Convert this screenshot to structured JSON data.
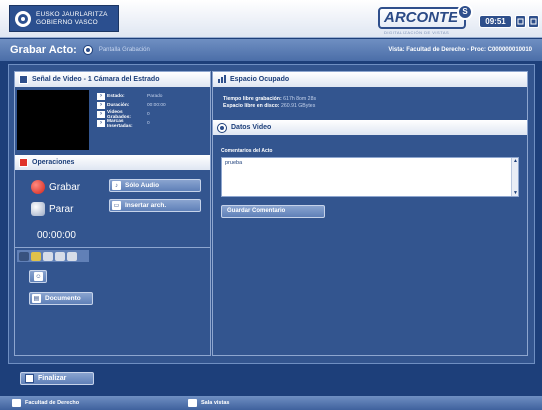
{
  "header": {
    "logo_line1": "EUSKO JAURLARITZA",
    "logo_line2": "GOBIERNO VASCO",
    "brand": "ARCONTE",
    "brand_badge": "S",
    "brand_sub": "DIGITALIZACIÓN DE VISTAS",
    "clock": "09:51"
  },
  "titlebar": {
    "title": "Grabar Acto:",
    "subtitle": "Pantalla Grabación",
    "right_info": "Vista: Facultad de Derecho - Proc: C000000010010"
  },
  "video_panel": {
    "title": "Señal de Video - 1 Cámara del Estrado",
    "info": [
      {
        "label": "Estado:",
        "value": "Parado"
      },
      {
        "label": "Duración:",
        "value": "00:00:00"
      },
      {
        "label": "Videos Grabados:",
        "value": "0"
      },
      {
        "label": "Marcas Insertadas:",
        "value": "0"
      }
    ]
  },
  "operations": {
    "title": "Operaciones",
    "record_label": "Grabar",
    "stop_label": "Parar",
    "audio_only_label": "Sólo Audio",
    "insert_file_label": "Insertar arch.",
    "timer": "00:00:00",
    "document_label": "Documento"
  },
  "space_panel": {
    "title": "Espacio Ocupado",
    "free_time_label": "Tiempo libre grabación:",
    "free_time_value": "617h 8om 28s",
    "free_disk_label": "Espacio libre en disco:",
    "free_disk_value": "260.91 GBytes"
  },
  "data_panel": {
    "title": "Datos Video",
    "comments_label": "Comentarios del Acto",
    "comment_value": "prueba",
    "save_label": "Guardar Comentario"
  },
  "bottom": {
    "finish_label": "Finalizar"
  },
  "footer": {
    "left": "Facultad de Derecho",
    "center": "Sala vistas"
  },
  "colors": {
    "background": "#1d3f7a",
    "panel": "#33558f",
    "header_band": "#4b6ea8",
    "record_red": "#e0332b"
  }
}
